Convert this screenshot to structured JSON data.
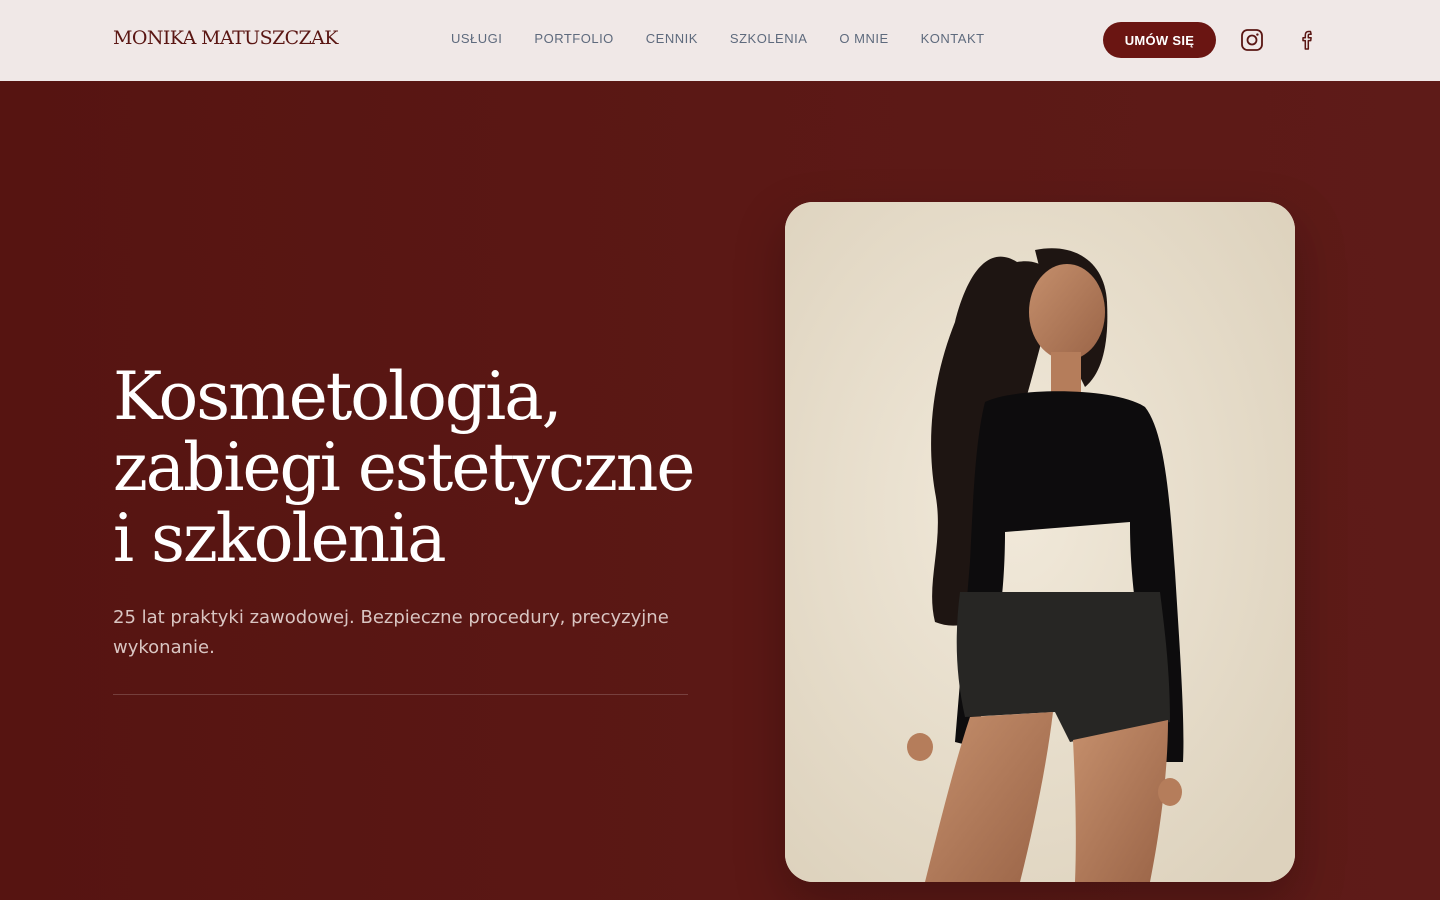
{
  "header": {
    "brand": "MONIKA MATUSZCZAK",
    "nav": [
      {
        "label": "USŁUGI"
      },
      {
        "label": "PORTFOLIO"
      },
      {
        "label": "CENNIK"
      },
      {
        "label": "SZKOLENIA"
      },
      {
        "label": "O MNIE"
      },
      {
        "label": "KONTAKT"
      }
    ],
    "cta_label": "UMÓW SIĘ",
    "social": [
      {
        "icon": "instagram-icon"
      },
      {
        "icon": "facebook-icon"
      }
    ]
  },
  "hero": {
    "title_lines": [
      "Kosmetologia,",
      "zabiegi estetyczne",
      "i szkolenia"
    ],
    "subtitle": "25 lat praktyki zawodowej. Bezpieczne procedury, precyzyjne wykonanie.",
    "image": "portrait-photo"
  },
  "colors": {
    "brand": "#5a1613",
    "header_bg": "#f0e8e7",
    "nav_text": "#5e6a7d",
    "cta_bg": "#6a1512",
    "hero_bg": "#5a1613",
    "photo_bg": "#ece3d2"
  }
}
